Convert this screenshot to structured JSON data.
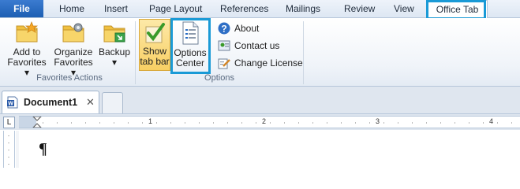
{
  "menu": {
    "file": "File",
    "tabs": [
      "Home",
      "Insert",
      "Page Layout",
      "References",
      "Mailings",
      "Review",
      "View",
      "Office Tab"
    ]
  },
  "ribbon": {
    "favorites_actions": {
      "label": "Favorites Actions",
      "buttons": [
        {
          "line1": "Add to",
          "line2": "Favorites ▾",
          "icon": "folder-star-icon"
        },
        {
          "line1": "Organize",
          "line2": "Favorites ▾",
          "icon": "folder-gear-icon"
        },
        {
          "line1": "Backup",
          "line2": "▾",
          "icon": "folder-arrow-icon"
        }
      ]
    },
    "options": {
      "label": "Options",
      "show_tab_bar": {
        "line1": "Show",
        "line2": "tab bar",
        "icon": "checkmark-icon"
      },
      "options_center": {
        "line1": "Options",
        "line2": "Center",
        "icon": "document-list-icon"
      },
      "small": [
        {
          "label": "About",
          "icon": "help-icon"
        },
        {
          "label": "Contact us",
          "icon": "contact-icon"
        },
        {
          "label": "Change License",
          "icon": "license-icon"
        }
      ]
    }
  },
  "document_tabs": {
    "active": "Document1",
    "close": "✕"
  },
  "ruler": {
    "button": "L",
    "marks": [
      "1",
      "2",
      "3",
      "4"
    ]
  },
  "document": {
    "mark": "¶"
  },
  "colors": {
    "highlight": "#1a9ad6",
    "file_tab": "#2a6cc2"
  }
}
